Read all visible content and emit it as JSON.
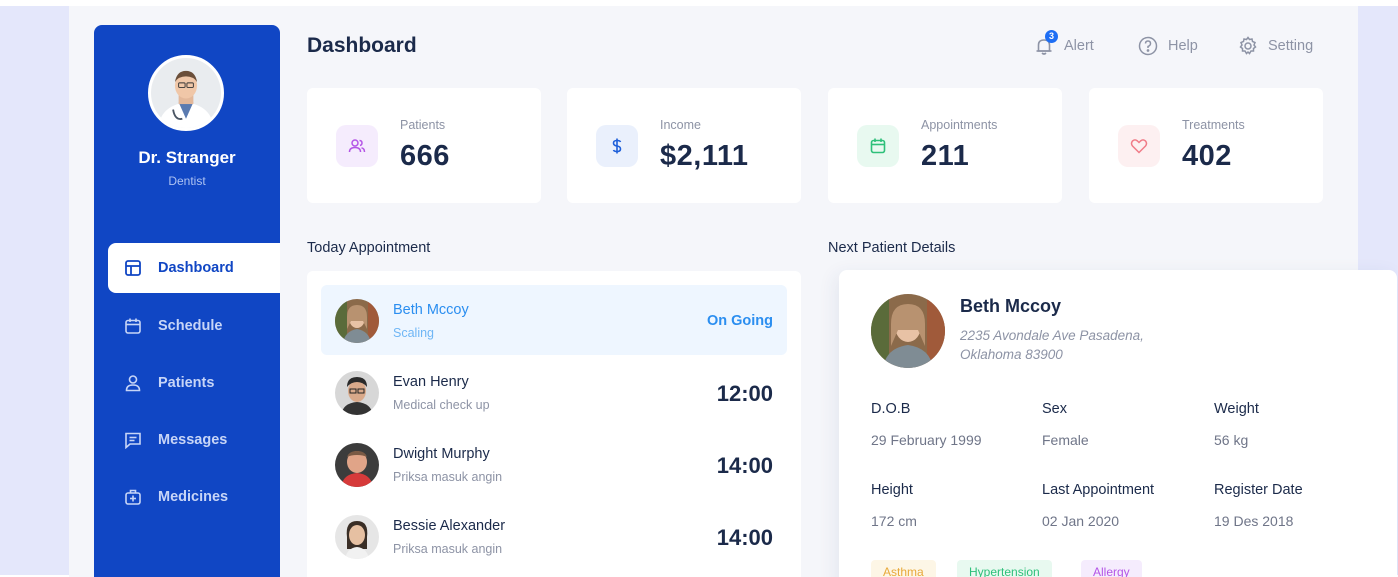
{
  "sidebar": {
    "doctor_name": "Dr. Stranger",
    "doctor_role": "Dentist",
    "nav": [
      {
        "label": "Dashboard",
        "icon": "layout-icon",
        "active": true
      },
      {
        "label": "Schedule",
        "icon": "calendar-icon",
        "active": false
      },
      {
        "label": "Patients",
        "icon": "user-icon",
        "active": false
      },
      {
        "label": "Messages",
        "icon": "message-icon",
        "active": false
      },
      {
        "label": "Medicines",
        "icon": "medkit-icon",
        "active": false
      }
    ]
  },
  "header": {
    "title": "Dashboard",
    "alert_label": "Alert",
    "alert_count": "3",
    "help_label": "Help",
    "setting_label": "Setting"
  },
  "stats": [
    {
      "label": "Patients",
      "value": "666",
      "icon": "users-icon",
      "color": "#b455e6",
      "bg": "#f5ecfd"
    },
    {
      "label": "Income",
      "value": "$2,111",
      "icon": "dollar-icon",
      "color": "#1e5fd9",
      "bg": "#eaf0fc"
    },
    {
      "label": "Appointments",
      "value": "211",
      "icon": "calendar-icon",
      "color": "#2ec07a",
      "bg": "#e8f9f0"
    },
    {
      "label": "Treatments",
      "value": "402",
      "icon": "heart-icon",
      "color": "#f07c88",
      "bg": "#fdf0f1"
    }
  ],
  "today": {
    "title": "Today Appointment",
    "rows": [
      {
        "name": "Beth Mccoy",
        "desc": "Scaling",
        "status": "On Going",
        "time": ""
      },
      {
        "name": "Evan Henry",
        "desc": "Medical check up",
        "status": "",
        "time": "12:00"
      },
      {
        "name": "Dwight Murphy",
        "desc": "Priksa masuk angin",
        "status": "",
        "time": "14:00"
      },
      {
        "name": "Bessie Alexander",
        "desc": "Priksa masuk angin",
        "status": "",
        "time": "14:00"
      }
    ]
  },
  "next_patient": {
    "title": "Next Patient Details",
    "name": "Beth Mccoy",
    "address_line1": "2235 Avondale Ave Pasadena,",
    "address_line2": "Oklahoma 83900",
    "fields": [
      {
        "label": "D.O.B",
        "value": "29 February 1999"
      },
      {
        "label": "Sex",
        "value": "Female"
      },
      {
        "label": "Weight",
        "value": "56 kg"
      },
      {
        "label": "Height",
        "value": "172 cm"
      },
      {
        "label": "Last Appointment",
        "value": "02 Jan 2020"
      },
      {
        "label": "Register Date",
        "value": "19 Des 2018"
      }
    ],
    "tags": [
      {
        "label": "Asthma",
        "color": "#e8a93a",
        "bg": "#fdf6e6"
      },
      {
        "label": "Hypertension",
        "color": "#2ec07a",
        "bg": "#e8f9f0"
      },
      {
        "label": "Allergy",
        "color": "#b455e6",
        "bg": "#f5ecfd"
      }
    ]
  },
  "colors": {
    "primary": "#1046c4",
    "accent": "#2b8ef0",
    "text_dark": "#1b2a4a",
    "text_muted": "#8d93a5"
  }
}
